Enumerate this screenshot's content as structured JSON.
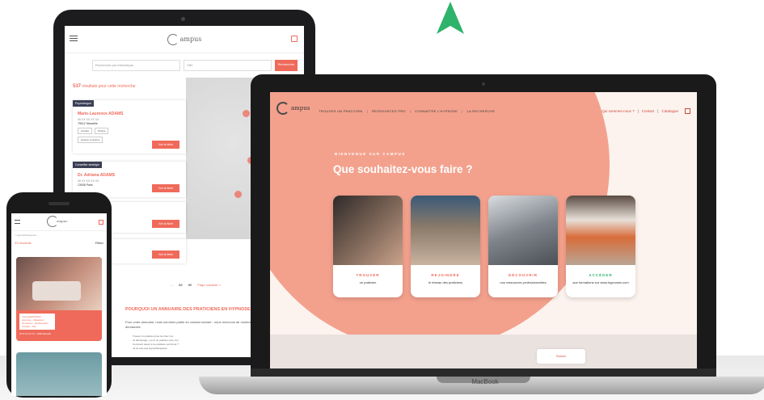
{
  "brand": {
    "logo_text": "ampus",
    "accent": "#ef6a5a",
    "salmon": "#f3a18d",
    "green_arrow": "#2db36b"
  },
  "tablet": {
    "search_placeholder": "Recherche par thématique",
    "city_placeholder": "Ville",
    "search_button": "Rechercher",
    "count_number": "537",
    "count_text": "résultats pour cette recherche",
    "cards": [
      {
        "tag": "Psychologue",
        "name": "Marie-Laurence ADAMS",
        "sub": "06 XX XX XX XX",
        "city": "75012 Marseille",
        "chips": [
          "Anxiété",
          "Phobie",
          "Gestion émotions"
        ],
        "cta": "Voir la fiche"
      },
      {
        "tag": "Conseiller stratégie",
        "name": "Dr. Adriana ADAMS",
        "sub": "06 XX XX XX XX",
        "city": "13008 Paris",
        "chips": [],
        "cta": "Voir la fiche"
      },
      {
        "tag": "Hypnothérapeute",
        "name": "",
        "sub": "",
        "city": "",
        "chips": [],
        "cta": "Voir la fiche"
      },
      {
        "tag": "",
        "name": "",
        "sub": "",
        "city": "",
        "chips": [],
        "cta": "Voir la fiche"
      }
    ],
    "pager": [
      "…",
      "88",
      "89",
      "Page suivante >"
    ],
    "why_title": "POURQUOI UN ANNUAIRE DES PRATICIENS EN HYPNOSE",
    "why_text": "Pour votre annuaire, nous sommes partis du constat suivant : nous recevons de nombreuses demandes",
    "why_list": [
      "Trouver un praticien près de chez moi",
      "Je déménage, y a-t-il un praticien vers moi",
      "Comment savoir si ce praticien est formé ?",
      "Je ne suis pas hypnothérapeute"
    ]
  },
  "laptop": {
    "menu": [
      "TROUVER UN PRATICIEN",
      "RESSOURCES PRO",
      "CONNAÎTRE L'HYPNOSE",
      "LA RECHERCHE"
    ],
    "right_links": [
      "Qui sommes-nous ?",
      "Contact",
      "Catalogue"
    ],
    "eyebrow": "BIENVENUE SUR CAMPUS",
    "title": "Que souhaitez-vous faire ?",
    "cards": [
      {
        "title": "TROUVER",
        "sub": "un praticien",
        "color": "#ef6a5a"
      },
      {
        "title": "REJOINDRE",
        "sub": "le réseau des praticiens",
        "color": "#ef6a5a"
      },
      {
        "title": "DÉCOUVRIR",
        "sub": "nos ressources professionnelles",
        "color": "#ef6a5a"
      },
      {
        "title": "ACCÉDER",
        "sub": "aux formations sur www.hypnoses.com",
        "color": "#2db36b"
      }
    ],
    "bottom_button": "Suivez",
    "brand_label": "MacBook"
  },
  "phone": {
    "crumb": "> Hypnothérapeutes",
    "count": "33 résultats",
    "filter": "Filtrer",
    "card_label": "Laura ERNSTEIN · Hypnose · Maladies / Nouveaux · Rééducation · Anxiété · Dél.",
    "card_sub": "Accompagnement psychique",
    "card_meta": "06 XX XX XX XX · 13008 Marseille"
  }
}
